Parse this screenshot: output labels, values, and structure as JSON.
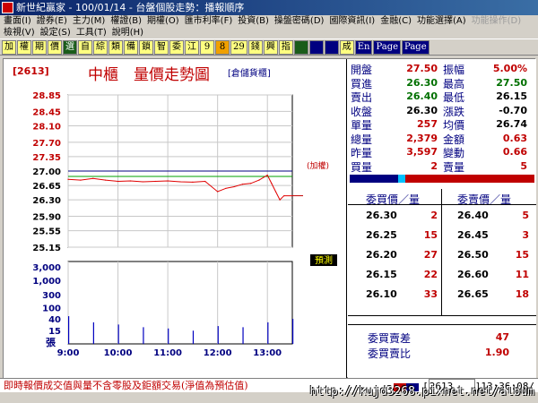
{
  "window": {
    "title": "新世紀贏家 - 100/01/14 - 台盤個股走勢：播報順序"
  },
  "menu": {
    "row1": [
      "畫面(I)",
      "證券(E)",
      "主力(M)",
      "權證(B)",
      "期權(O)",
      "匯市利率(F)",
      "投資(B)",
      "操盤密碼(D)",
      "國際資訊(I)",
      "金融(C)",
      "功能選擇(A)",
      "功能操作(D)"
    ],
    "row2": [
      "檢視(V)",
      "設定(S)",
      "工具(T)",
      "說明(H)"
    ]
  },
  "toolbar": {
    "buttons": [
      "加",
      "權",
      "期",
      "價",
      "選",
      "自",
      "綜",
      "類",
      "備",
      "鎖",
      "智",
      "委",
      "江",
      "9",
      "8",
      "29",
      "錢",
      "興",
      "指",
      "",
      "",
      "",
      "成",
      "En",
      "Page",
      "Page"
    ]
  },
  "chart": {
    "code": "[2613]",
    "title": "中櫃　量價走勢圖",
    "subtitle": "[倉儲貨櫃]",
    "ref_label": "(加權)",
    "hint_label": "預測",
    "unit_label": "張",
    "price_ticks": [
      "28.85",
      "28.45",
      "28.10",
      "27.70",
      "27.35",
      "27.00",
      "26.65",
      "26.30",
      "25.90",
      "25.55",
      "25.15"
    ],
    "volume_ticks": [
      "3,000",
      "1,000",
      "300",
      "100",
      "40",
      "15"
    ],
    "time_ticks": [
      "9:00",
      "10:00",
      "11:00",
      "12:00",
      "13:00"
    ]
  },
  "chart_data": {
    "type": "line",
    "title": "中櫃　量價走勢圖",
    "xlabel": "",
    "ylabel": "",
    "x_range": [
      "9:00",
      "13:30"
    ],
    "ylim": [
      25.15,
      28.85
    ],
    "reference_price": 27.0,
    "series": [
      {
        "x": [
          "9:00",
          "9:15",
          "9:30",
          "9:45",
          "10:00",
          "10:15",
          "10:30",
          "10:45",
          "11:00",
          "11:15",
          "11:30",
          "11:45",
          "12:00",
          "12:10",
          "12:20",
          "12:30",
          "12:40",
          "12:50",
          "13:00",
          "13:05",
          "13:10",
          "13:15",
          "13:20",
          "13:30"
        ],
        "values": [
          26.8,
          26.78,
          26.82,
          26.78,
          26.75,
          26.76,
          26.74,
          26.75,
          26.76,
          26.74,
          26.73,
          26.75,
          26.5,
          26.58,
          26.62,
          26.68,
          26.7,
          26.78,
          26.9,
          26.7,
          26.5,
          26.3,
          26.4,
          26.4
        ]
      }
    ],
    "volume": {
      "unit": "張",
      "x": [
        "9:00",
        "9:30",
        "10:00",
        "10:30",
        "11:00",
        "11:30",
        "12:00",
        "12:30",
        "13:00",
        "13:30"
      ],
      "values": [
        50,
        30,
        25,
        20,
        18,
        15,
        22,
        20,
        30,
        40
      ]
    }
  },
  "quote": {
    "rows": [
      {
        "l1": "開盤",
        "v1": "27.50",
        "l2": "振幅",
        "v2": "5.00%"
      },
      {
        "l1": "買進",
        "v1": "26.30",
        "l2": "最高",
        "v2": "27.50"
      },
      {
        "l1": "賣出",
        "v1": "26.40",
        "l2": "最低",
        "v2": "26.15"
      },
      {
        "l1": "收盤",
        "v1": "26.30",
        "l2": "漲跌",
        "v2": "-0.70"
      },
      {
        "l1": "單量",
        "v1": "257",
        "l2": "均價",
        "v2": "26.74"
      },
      {
        "l1": "總量",
        "v1": "2,379",
        "l2": "金額",
        "v2": "0.63"
      },
      {
        "l1": "昨量",
        "v1": "3,597",
        "l2": "變動",
        "v2": "0.66"
      },
      {
        "l1": "買量",
        "v1": "2",
        "l2": "賣量",
        "v2": "5"
      }
    ]
  },
  "orderbook": {
    "bid_header": "委買價／量",
    "ask_header": "委賣價／量",
    "bids": [
      {
        "price": "26.30",
        "qty": "2"
      },
      {
        "price": "26.25",
        "qty": "15"
      },
      {
        "price": "26.20",
        "qty": "27"
      },
      {
        "price": "26.15",
        "qty": "22"
      },
      {
        "price": "26.10",
        "qty": "33"
      }
    ],
    "asks": [
      {
        "price": "26.40",
        "qty": "5"
      },
      {
        "price": "26.45",
        "qty": "3"
      },
      {
        "price": "26.50",
        "qty": "15"
      },
      {
        "price": "26.60",
        "qty": "11"
      },
      {
        "price": "26.65",
        "qty": "18"
      }
    ],
    "diff_label": "委買賣差",
    "diff_value": "47",
    "ratio_label": "委買賣比",
    "ratio_value": "1.90"
  },
  "status": {
    "note": "即時報價成交值與量不含零股及鉅額交易(淨值為預估值)",
    "code": "2613",
    "time": "13:36:08"
  },
  "watermark": "http://kujd3268.pixnet.net/album"
}
